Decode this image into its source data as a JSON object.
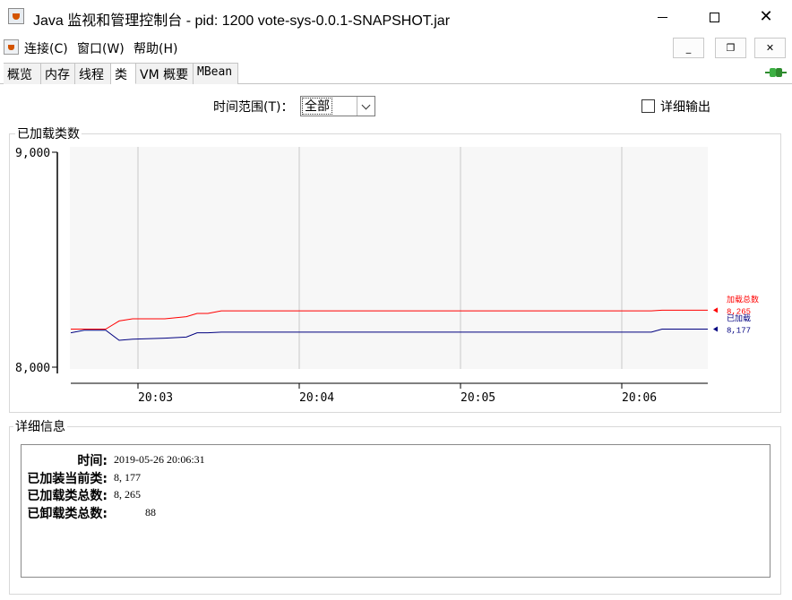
{
  "window": {
    "title": "Java 监视和管理控制台 - pid: 1200 vote-sys-0.0.1-SNAPSHOT.jar",
    "min_label": "–",
    "max_label": "□",
    "close_label": "✕"
  },
  "menu": {
    "items": [
      {
        "label": "连接(C)"
      },
      {
        "label": "窗口(W)"
      },
      {
        "label": "帮助(H)"
      }
    ],
    "inner_min": "_",
    "inner_restore": "❐",
    "inner_close": "✕"
  },
  "tabs": [
    {
      "label": "概览"
    },
    {
      "label": "内存"
    },
    {
      "label": "线程"
    },
    {
      "label": "类"
    },
    {
      "label": "VM 概要"
    },
    {
      "label": "MBean"
    }
  ],
  "active_tab": "类",
  "controls": {
    "range_label": "时间范围(T)：",
    "range_value": "全部",
    "verbose_label": "详细输出",
    "verbose_checked": false
  },
  "chart_panel": {
    "title": "已加载类数"
  },
  "chart_data": {
    "type": "line",
    "y_top_label": "9,000",
    "y_bottom_label": "8,000",
    "ylim": [
      8000,
      9000
    ],
    "x_tick_labels": [
      "20:03",
      "20:04",
      "20:05",
      "20:06"
    ],
    "x_range": [
      "20:02:35",
      "20:06:32"
    ],
    "series": [
      {
        "name": "加载总数",
        "value_label": "8,265",
        "color": "#ff0000",
        "points": [
          [
            "20:02:35",
            8177
          ],
          [
            "20:02:48",
            8177
          ],
          [
            "20:02:53",
            8215
          ],
          [
            "20:02:58",
            8225
          ],
          [
            "20:03:10",
            8225
          ],
          [
            "20:03:18",
            8235
          ],
          [
            "20:03:22",
            8250
          ],
          [
            "20:03:26",
            8250
          ],
          [
            "20:03:31",
            8262
          ],
          [
            "20:06:11",
            8262
          ],
          [
            "20:06:15",
            8265
          ],
          [
            "20:06:32",
            8265
          ]
        ]
      },
      {
        "name": "已加载",
        "value_label": "8,177",
        "color": "#000080",
        "points": [
          [
            "20:02:35",
            8160
          ],
          [
            "20:02:40",
            8172
          ],
          [
            "20:02:48",
            8172
          ],
          [
            "20:02:53",
            8125
          ],
          [
            "20:02:58",
            8130
          ],
          [
            "20:03:10",
            8135
          ],
          [
            "20:03:18",
            8140
          ],
          [
            "20:03:22",
            8160
          ],
          [
            "20:03:26",
            8160
          ],
          [
            "20:03:31",
            8163
          ],
          [
            "20:06:11",
            8163
          ],
          [
            "20:06:15",
            8177
          ],
          [
            "20:06:32",
            8177
          ]
        ]
      }
    ]
  },
  "details_panel": {
    "title": "详细信息",
    "rows": [
      {
        "label": "时间:",
        "value": "2019-05-26 20:06:31"
      },
      {
        "label": "已加装当前类:",
        "value": "8, 177"
      },
      {
        "label": "已加载类总数:",
        "value": "8, 265"
      },
      {
        "label": "已卸载类总数:",
        "value": "88"
      }
    ]
  }
}
